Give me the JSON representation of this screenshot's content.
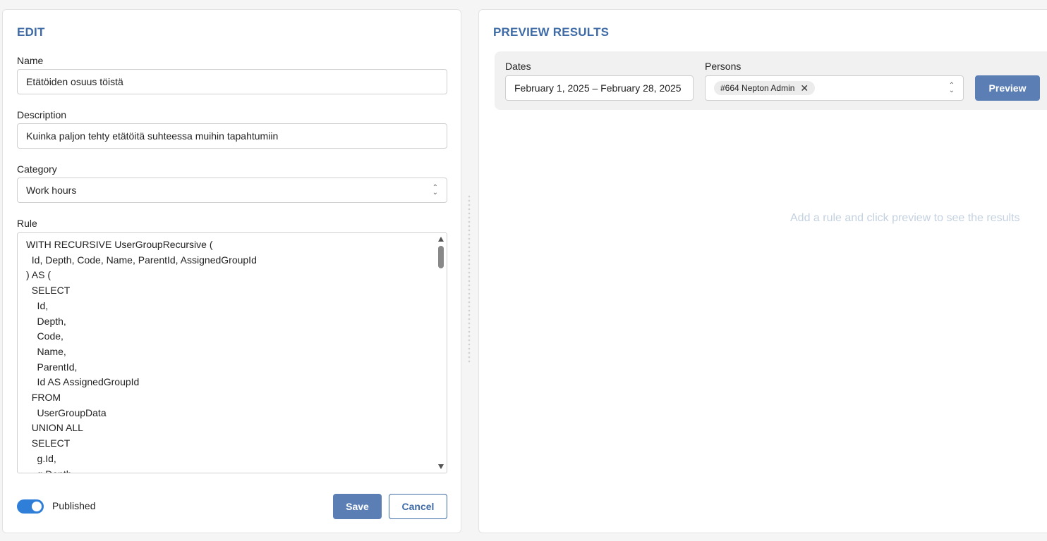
{
  "edit": {
    "title": "EDIT",
    "name_label": "Name",
    "name_value": "Etätöiden osuus töistä",
    "description_label": "Description",
    "description_value": "Kuinka paljon tehty etätöitä suhteessa muihin tapahtumiin",
    "category_label": "Category",
    "category_value": "Work hours",
    "rule_label": "Rule",
    "rule_code": "WITH RECURSIVE UserGroupRecursive (\n  Id, Depth, Code, Name, ParentId, AssignedGroupId\n) AS (\n  SELECT\n    Id,\n    Depth,\n    Code,\n    Name,\n    ParentId,\n    Id AS AssignedGroupId\n  FROM\n    UserGroupData\n  UNION ALL\n  SELECT\n    g.Id,\n    g.Depth,",
    "published_label": "Published",
    "published": true,
    "save_label": "Save",
    "cancel_label": "Cancel"
  },
  "preview": {
    "title": "PREVIEW RESULTS",
    "dates_label": "Dates",
    "dates_value": "February 1, 2025 – February 28, 2025",
    "persons_label": "Persons",
    "person_chip": "#664 Nepton Admin",
    "preview_button": "Preview",
    "empty_message": "Add a rule and click preview to see the results"
  },
  "colors": {
    "accent": "#3e6aa5",
    "primary_button": "#5b7fb5",
    "toggle_on": "#2f7fd9",
    "empty_text": "#c4d1e0"
  }
}
